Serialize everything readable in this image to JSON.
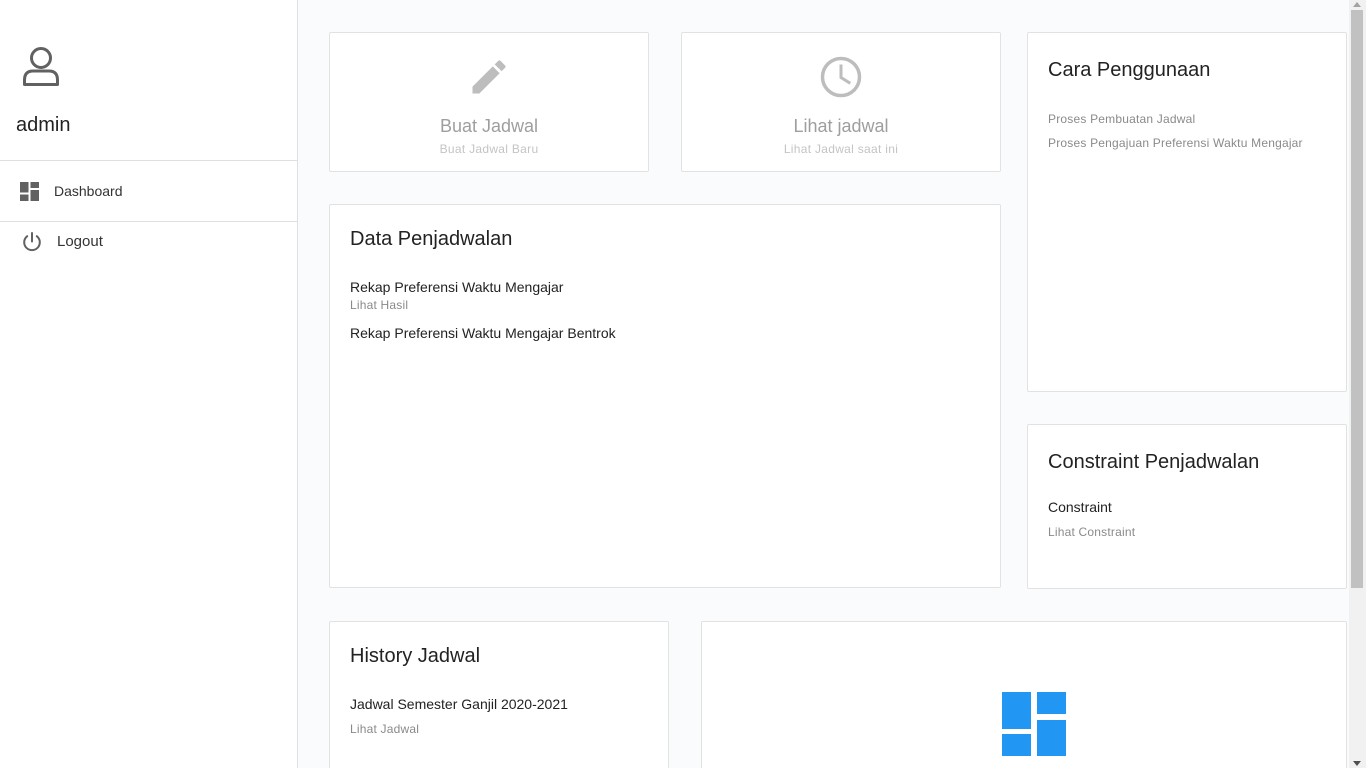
{
  "sidebar": {
    "user_name": "admin",
    "items": [
      {
        "label": "Dashboard",
        "icon": "dashboard-icon"
      },
      {
        "label": "Logout",
        "icon": "power-icon"
      }
    ]
  },
  "actions": {
    "create": {
      "title": "Buat Jadwal",
      "subtitle": "Buat Jadwal Baru",
      "icon": "pencil-icon"
    },
    "view": {
      "title": "Lihat jadwal",
      "subtitle": "Lihat Jadwal saat ini",
      "icon": "clock-icon"
    }
  },
  "cara": {
    "title": "Cara Penggunaan",
    "links": [
      "Proses Pembuatan Jadwal",
      "Proses Pengajuan Preferensi Waktu Mengajar"
    ]
  },
  "data_penjadwalan": {
    "title": "Data Penjadwalan",
    "items": [
      {
        "title": "Rekap Preferensi Waktu Mengajar",
        "sub": "Lihat Hasil"
      },
      {
        "title": "Rekap Preferensi Waktu Mengajar Bentrok"
      }
    ]
  },
  "constraint": {
    "title": "Constraint Penjadwalan",
    "item_title": "Constraint",
    "item_sub": "Lihat Constraint"
  },
  "history": {
    "title": "History Jadwal",
    "item_title": "Jadwal Semester Ganjil 2020-2021",
    "item_sub": "Lihat Jadwal"
  },
  "colors": {
    "brand_blue": "#2196f3",
    "icon_gray": "#bdbdbd",
    "sidebar_icon": "#616161"
  }
}
